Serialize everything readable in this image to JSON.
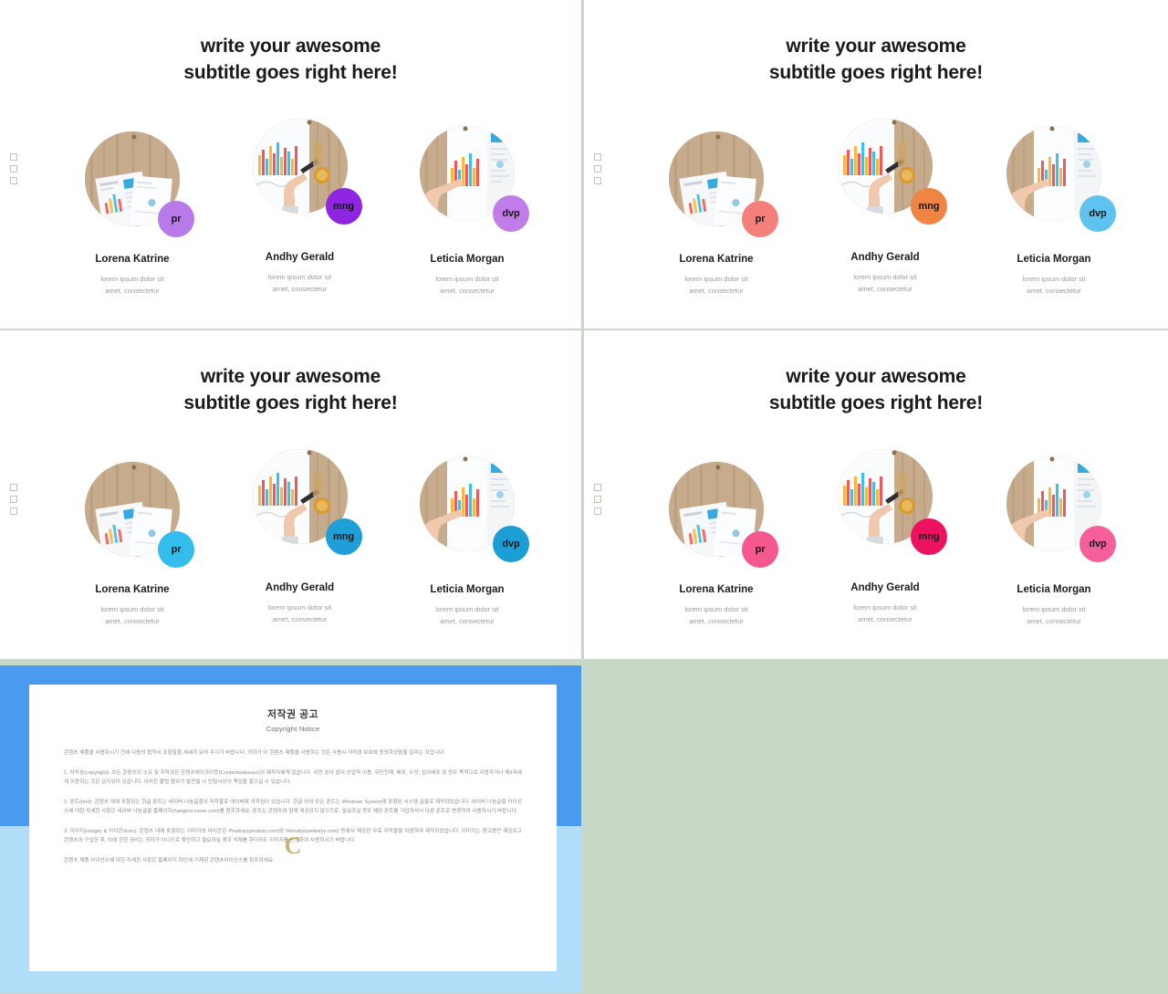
{
  "theme": {
    "page_background": "#c7d9c6",
    "slide_background": "#ffffff",
    "title_color": "#1a1a1a"
  },
  "slide_title": {
    "line1": "write your awesome",
    "line2": "subtitle goes right here!"
  },
  "people": [
    {
      "name": "Lorena Katrine",
      "desc_line1": "lorem ipsum dolor sit",
      "desc_line2": "amet, consectetur",
      "badge": "pr",
      "photo": "desk-papers-chart-photo"
    },
    {
      "name": "Andhy Gerald",
      "desc_line1": "lorem ipsum dolor sit",
      "desc_line2": "amet, consectetur",
      "badge": "mng",
      "photo": "hand-drawing-chart-photo"
    },
    {
      "name": "Leticia Morgan",
      "desc_line1": "lorem ipsum dolor sit",
      "desc_line2": "amet, consectetur",
      "badge": "dvp",
      "photo": "hand-pointing-report-photo"
    }
  ],
  "slides": [
    {
      "id": "slide-purple",
      "badge_colors": [
        "#b77ae8",
        "#8f25e0",
        "#c07ce8"
      ]
    },
    {
      "id": "slide-warm",
      "badge_colors": [
        "#f4807c",
        "#f08443",
        "#5fc3ef"
      ]
    },
    {
      "id": "slide-blue",
      "badge_colors": [
        "#32bdec",
        "#1e9fd8",
        "#1b9ed6"
      ]
    },
    {
      "id": "slide-pink",
      "badge_colors": [
        "#f5578f",
        "#ec1260",
        "#f5609a"
      ]
    }
  ],
  "copyright": {
    "title": "저작권 공고",
    "subtitle": "Copyright Notice",
    "intro": "콘텐츠 제품을 사용하시기 전에 다음의 협약서 조항들을 세세히 읽어 주시기 바랍니다. 귀하가 이 콘텐츠 제품을 사용하는 것은 사용시 저작권 보호에 동의하셨음을 알리는 것입니다.",
    "section1": "1. 저작권(copyright): 모든 콘텐츠의 소유 및 저작권은 콘텐츠테이크아웃(Contentstakeout)의 제작자에게 있습니다. 사전 승낙 없이 상업적 이용, 무단전재, 배포, 수정, 임의배포 및 양도 목적으로 이용하거나 제3자에게 이용하는 것은 금지되어 있습니다. 이러한 불법 행위가 발견될 시 민형사상의 책임을 물으실 수 있습니다.",
    "section2": "2. 폰트(font): 콘텐츠 내에 포함되는 한글 폰트는 네이버 나눔글꼴의 저작물로 네이버에 저작권이 있습니다. 한글 외의 모든 폰트는 Windows System에 포함된 시스템 글꼴로 제작되었습니다. 네이버 나눔글꼴 라이선스에 대한 자세한 사항은 네이버 나눔글꼴 홈페이지(hangeul.naver.com)를 참조하세요. 폰트는 콘텐츠와 함께 제공되지 않으므로, 필요하실 경우 해당 폰트를 가입하셔서 다른 폰트로 변경하여 사용하시기 바랍니다.",
    "section3": "3. 이미지(image) & 아이콘(icon): 콘텐츠 내에 포함되는 이미지와 아이콘은 Pixabay(pixabay.com)와 Webalys(webalys.com) 등에서 제공한 무료 저작물을 이용하여 제작되었습니다. 이미지는 참고용만 제공되고 콘텐츠의 구입한 후, 이에 관한 권리는 귀하가 아니므로 확인하고 필요하실 경우 삭제를 하더라도 이미지를 변경하여 사용하시기 바랍니다.",
    "footer": "콘텐츠 제품 라이선스에 대한 자세한 사항은 홈페이지 하단에 기재된 콘텐츠라이선스를 참조하세요.",
    "watermark": "C",
    "border_color_top": "#4a9bf0",
    "border_color_bottom": "#b2ddf8"
  }
}
